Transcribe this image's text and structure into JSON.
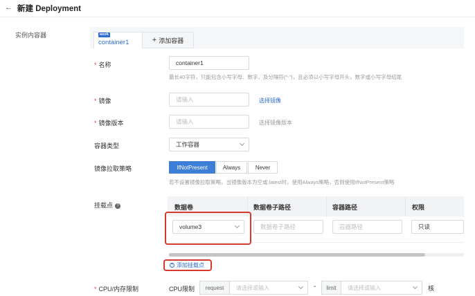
{
  "header": {
    "title": "新建 Deployment",
    "back_icon": "arrow-left-icon"
  },
  "section_label": "实例内容器",
  "tabs": {
    "active": {
      "badge": "work",
      "label": "container1"
    },
    "add_label": "添加容器"
  },
  "form": {
    "name": {
      "label": "名称",
      "value": "container1",
      "hint": "最长40字符，只能包含小写字母、数字、及分隔符(\"-\")，且必须以小写字母开头，数字或小写字母结尾"
    },
    "image": {
      "label": "镜像",
      "placeholder": "请输入",
      "link": "选择镜像"
    },
    "image_version": {
      "label": "镜像版本",
      "placeholder": "请输入",
      "link": "选择镜像版本"
    },
    "container_type": {
      "label": "容器类型",
      "value": "工作容器"
    },
    "pull_policy": {
      "label": "镜像拉取策略",
      "options": [
        "IfNotPresent",
        "Always",
        "Never"
      ],
      "selected": "IfNotPresent",
      "hint": "若不设置镜像拉取策略，当镜像版本为空或:latest时，使用Always策略，否则使用IfNotPresent策略"
    },
    "mount": {
      "label": "挂载点",
      "columns": [
        "数据卷",
        "数据卷子路径",
        "容器路径",
        "权限"
      ],
      "row": {
        "volume": "volume3",
        "subpath_placeholder": "数据卷子路径",
        "container_path_placeholder": "容器路径",
        "permission": "只读"
      },
      "add_label": "添加挂载点"
    },
    "cpu_mem": {
      "label": "CPU/内存限制",
      "cpu_label": "CPU限制",
      "request_label": "request",
      "limit_label": "limit",
      "placeholder": "请选择或输入",
      "separator": "-",
      "unit": "核"
    }
  },
  "colors": {
    "accent": "#2f6ccf",
    "highlight": "#d33a2c",
    "required": "#e54545"
  }
}
